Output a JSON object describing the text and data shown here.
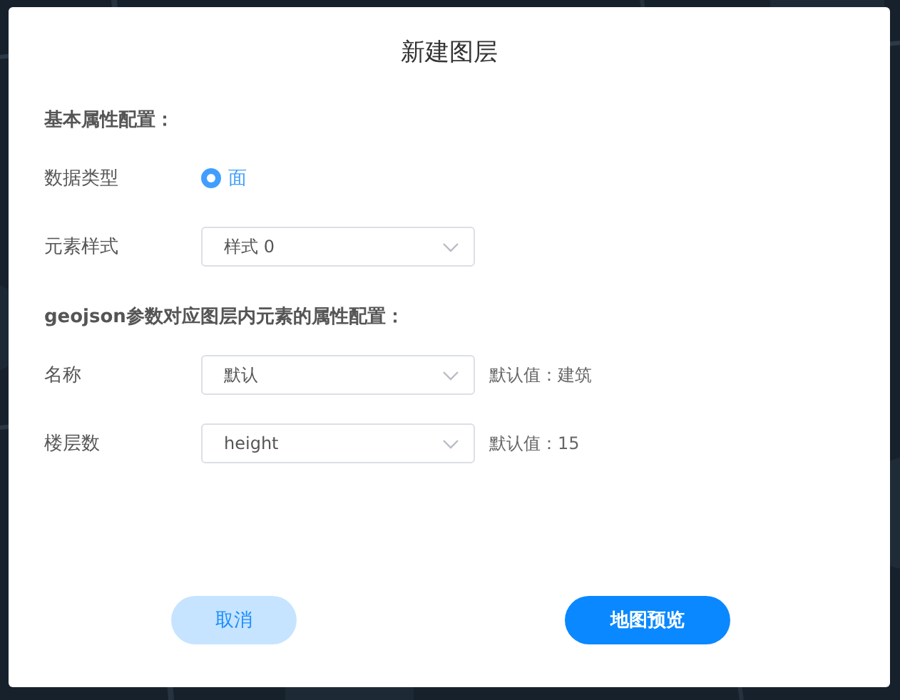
{
  "dialog": {
    "title": "新建图层"
  },
  "sections": [
    {
      "heading": "基本属性配置：",
      "rows": [
        {
          "kind": "radio",
          "label": "数据类型",
          "options": [
            {
              "label": "面",
              "selected": true
            }
          ]
        },
        {
          "kind": "select",
          "label": "元素样式",
          "value": "样式 0"
        }
      ]
    },
    {
      "heading": "geojson参数对应图层内元素的属性配置：",
      "rows": [
        {
          "kind": "select",
          "label": "名称",
          "value": "默认",
          "hint": "默认值：建筑"
        },
        {
          "kind": "select",
          "label": "楼层数",
          "value": "height",
          "hint": "默认值：15"
        }
      ]
    }
  ],
  "buttons": [
    {
      "label": "取消",
      "kind": "secondary"
    },
    {
      "label": "地图预览",
      "kind": "primary"
    }
  ]
}
